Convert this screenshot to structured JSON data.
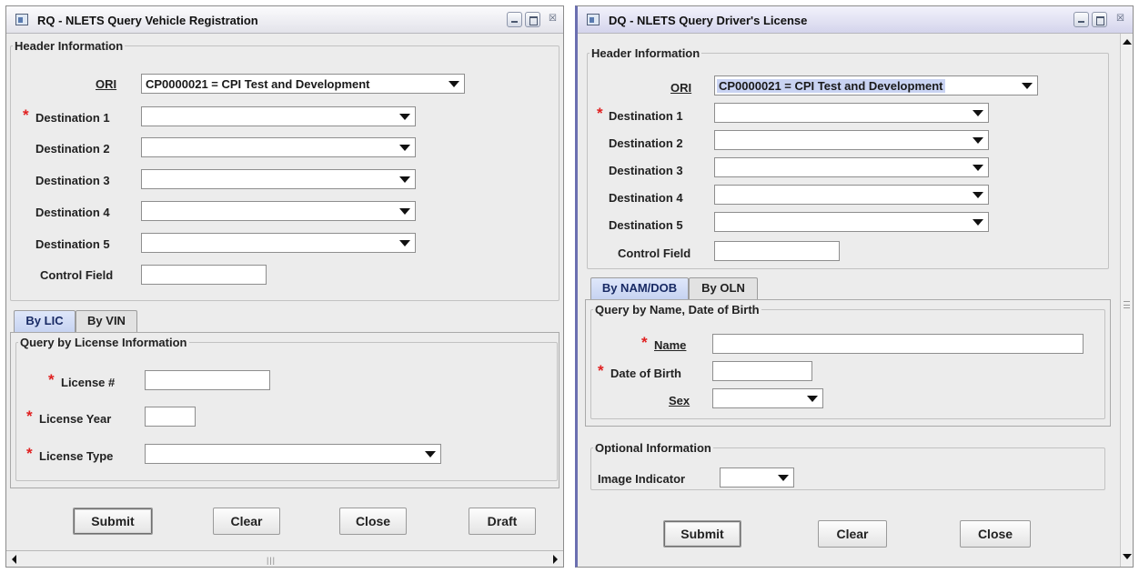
{
  "rq": {
    "title": "RQ - NLETS Query Vehicle Registration",
    "header_legend": "Header Information",
    "ori_label": "ORI",
    "ori_value": "CP0000021 = CPI Test and Development",
    "destinations": [
      "Destination 1",
      "Destination 2",
      "Destination 3",
      "Destination 4",
      "Destination 5"
    ],
    "control_field_label": "Control Field",
    "tabs": [
      "By LIC",
      "By VIN"
    ],
    "query_legend": "Query by License Information",
    "license_num_label": "License #",
    "license_year_label": "License Year",
    "license_type_label": "License Type",
    "buttons": {
      "submit": "Submit",
      "clear": "Clear",
      "close": "Close",
      "draft": "Draft"
    }
  },
  "dq": {
    "title": "DQ - NLETS Query Driver's License",
    "header_legend": "Header Information",
    "ori_label": "ORI",
    "ori_value": "CP0000021 = CPI Test and Development",
    "destinations": [
      "Destination 1",
      "Destination 2",
      "Destination 3",
      "Destination 4",
      "Destination 5"
    ],
    "control_field_label": "Control Field",
    "tabs": [
      "By NAM/DOB",
      "By OLN"
    ],
    "query_legend": "Query by Name, Date of Birth",
    "name_label": "Name",
    "dob_label": "Date of Birth",
    "sex_label": "Sex",
    "optional_legend": "Optional Information",
    "image_indicator_label": "Image Indicator",
    "buttons": {
      "submit": "Submit",
      "clear": "Clear",
      "close": "Close"
    }
  },
  "colors": {
    "required_star": "#e02020",
    "active_tab": "#c6d3f1",
    "selection_highlight": "#c9d3f2"
  }
}
